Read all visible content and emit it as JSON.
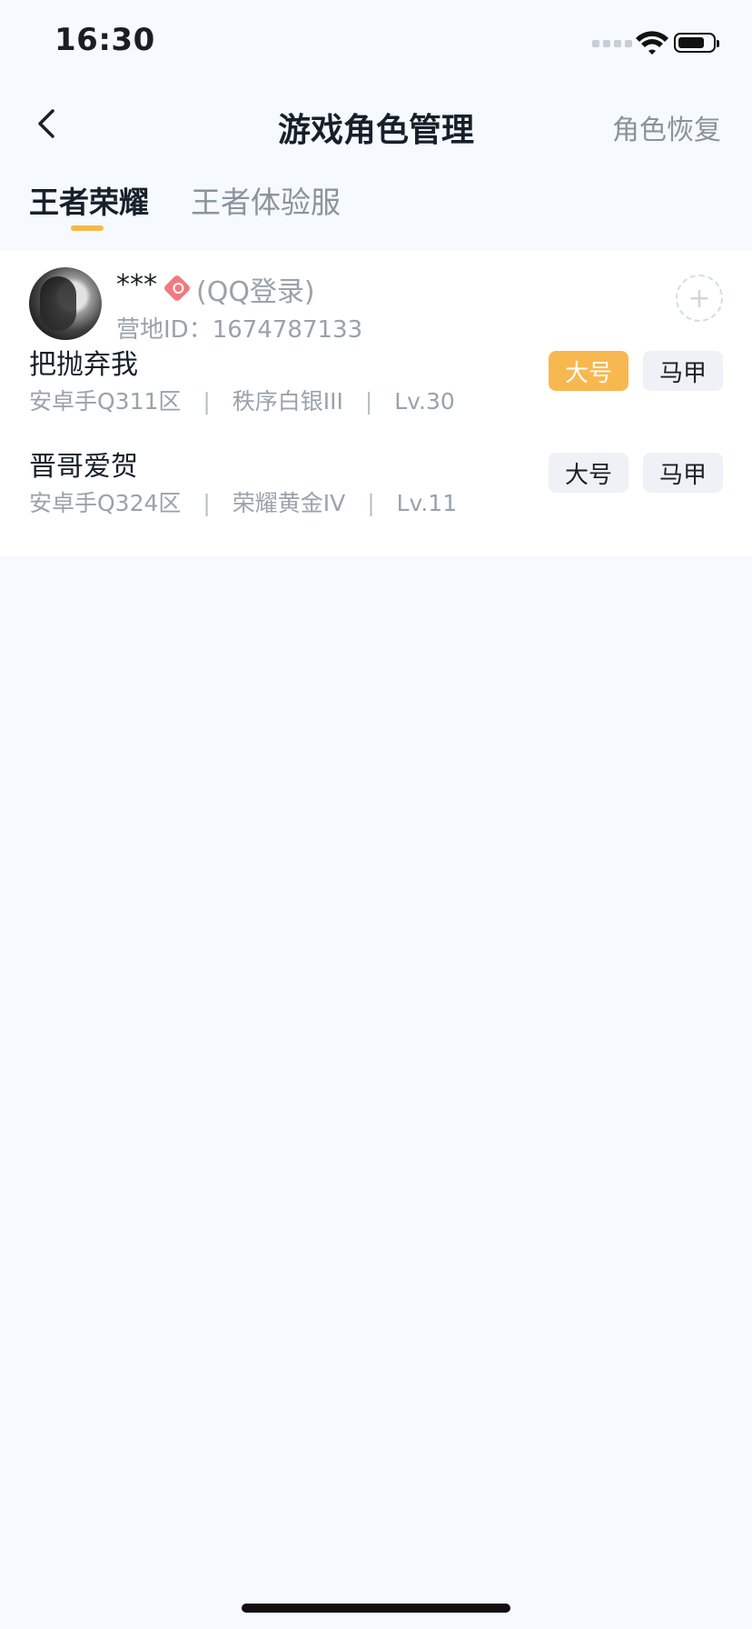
{
  "status_bar": {
    "time": "16:30"
  },
  "nav": {
    "back": "back",
    "title": "游戏角色管理",
    "restore_label": "角色恢复"
  },
  "tabs": [
    {
      "label": "王者荣耀",
      "active": true
    },
    {
      "label": "王者体验服",
      "active": false
    }
  ],
  "account": {
    "name": "***",
    "login_type": "(QQ登录)",
    "camp_id_label": "营地ID：",
    "camp_id": "1674787133",
    "add_label": "+"
  },
  "roles": [
    {
      "name": "把抛弃我",
      "region": "安卓手Q311区",
      "rank": "秩序白银III",
      "level": "Lv.30",
      "buttons": [
        "大号",
        "马甲"
      ],
      "main_active": true
    },
    {
      "name": "晋哥爱贺",
      "region": "安卓手Q324区",
      "rank": "荣耀黄金IV",
      "level": "Lv.11",
      "buttons": [
        "大号",
        "马甲"
      ],
      "main_active": false
    }
  ],
  "colors": {
    "accent": "#f7b84f",
    "text_muted": "#9aa2aa",
    "background": "#f6f9fd"
  }
}
